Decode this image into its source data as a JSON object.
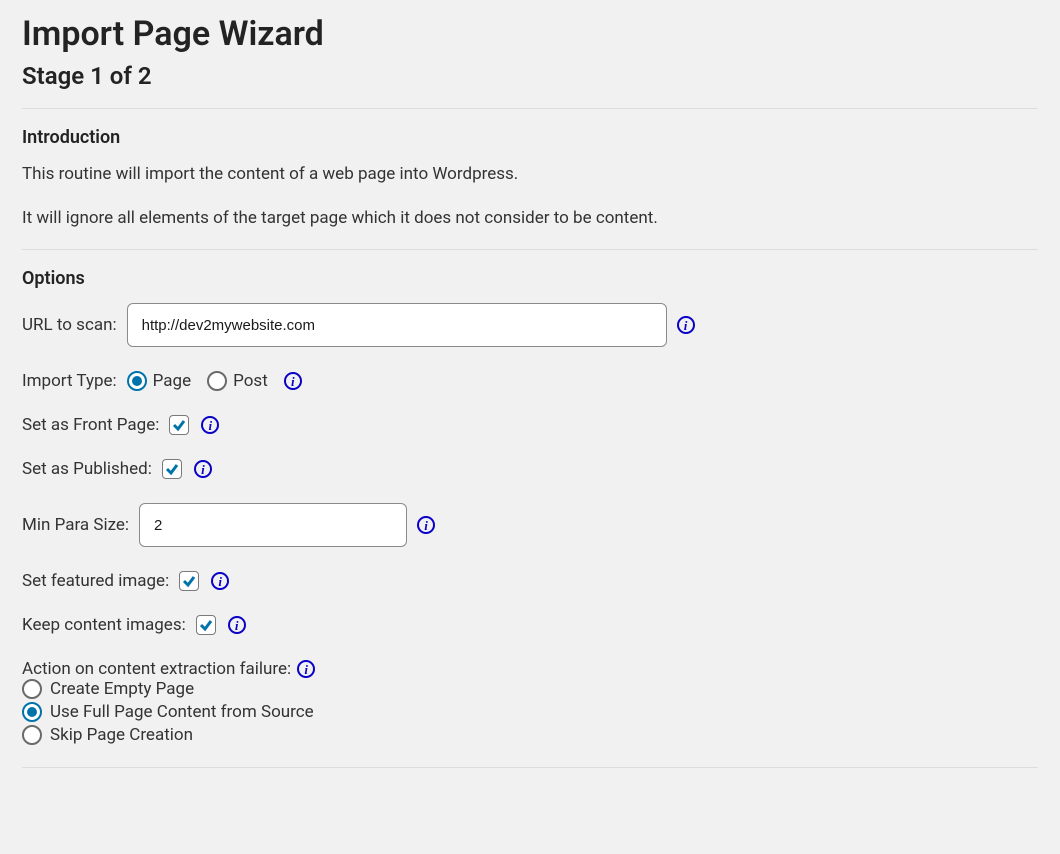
{
  "header": {
    "title": "Import Page Wizard",
    "stage": "Stage 1 of 2"
  },
  "intro": {
    "heading": "Introduction",
    "line1": "This routine will import the content of a web page into Wordpress.",
    "line2": "It will ignore all elements of the target page which it does not consider to be content."
  },
  "options": {
    "heading": "Options",
    "url_label": "URL to scan:",
    "url_value": "http://dev2mywebsite.com",
    "import_type_label": "Import Type:",
    "import_type_page": "Page",
    "import_type_post": "Post",
    "front_page_label": "Set as Front Page:",
    "published_label": "Set as Published:",
    "min_para_label": "Min Para Size:",
    "min_para_value": "2",
    "featured_label": "Set featured image:",
    "keep_images_label": "Keep content images:",
    "failure_label": "Action on content extraction failure:",
    "failure_opt1": "Create Empty Page",
    "failure_opt2": "Use Full Page Content from Source",
    "failure_opt3": "Skip Page Creation"
  }
}
